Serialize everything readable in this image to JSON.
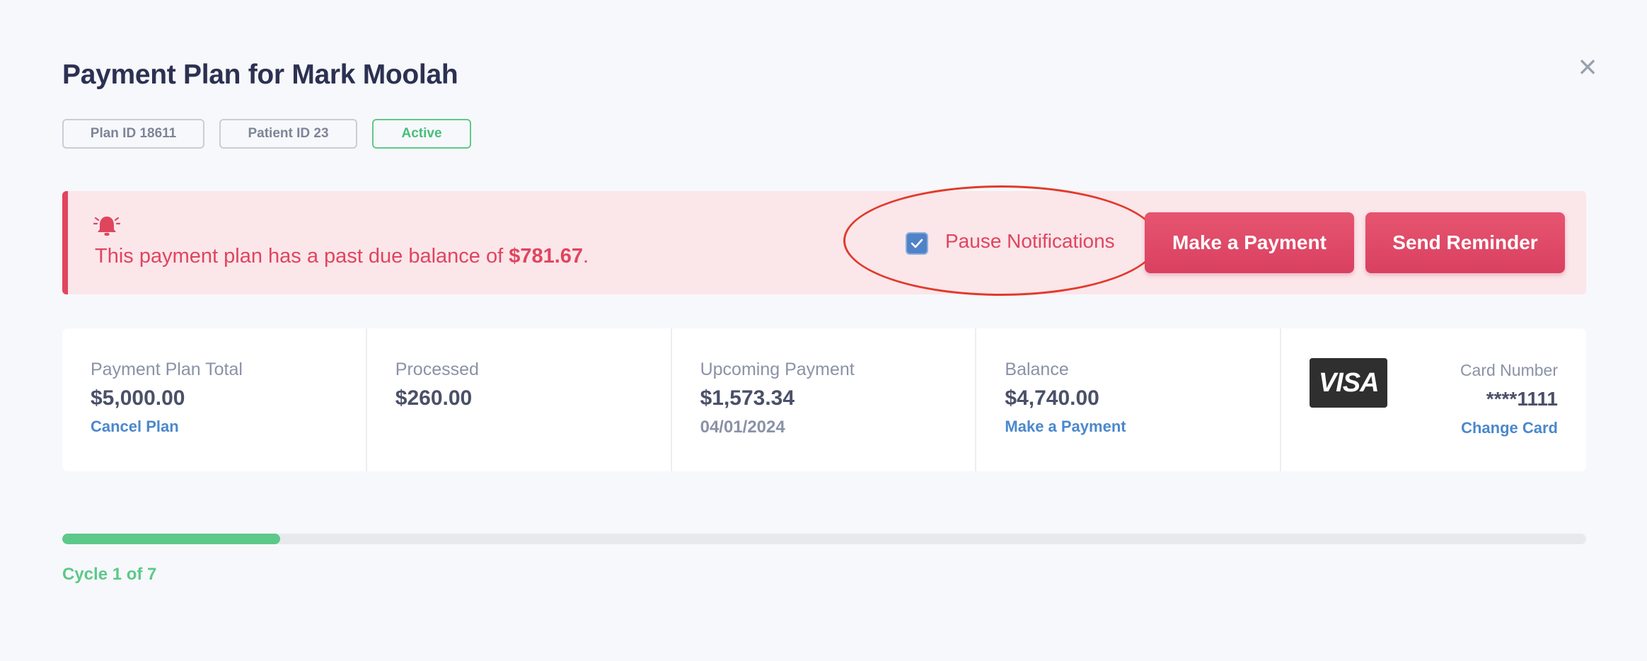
{
  "modal": {
    "title": "Payment Plan for Mark Moolah",
    "close_icon": "close-icon",
    "close_glyph": "×"
  },
  "badges": {
    "plan_id": "Plan ID 18611",
    "patient_id": "Patient ID 23",
    "status": "Active"
  },
  "alert": {
    "icon": "bell-icon",
    "message_prefix": "This payment plan has a past due balance of ",
    "amount": "$781.67",
    "message_suffix": ".",
    "pause_label": "Pause Notifications",
    "pause_checked": true,
    "make_payment_label": "Make a Payment",
    "send_reminder_label": "Send Reminder",
    "accent_color": "#e0455e"
  },
  "stats": {
    "total": {
      "label": "Payment Plan Total",
      "value": "$5,000.00",
      "link": "Cancel Plan"
    },
    "processed": {
      "label": "Processed",
      "value": "$260.00"
    },
    "upcoming": {
      "label": "Upcoming Payment",
      "value": "$1,573.34",
      "date": "04/01/2024"
    },
    "balance": {
      "label": "Balance",
      "value": "$4,740.00",
      "link": "Make a Payment"
    },
    "card": {
      "brand": "VISA",
      "label": "Card Number",
      "number": "****1111",
      "link": "Change Card"
    }
  },
  "progress": {
    "fraction": 0.143,
    "label": "Cycle 1 of 7",
    "color": "#5cc88a"
  }
}
